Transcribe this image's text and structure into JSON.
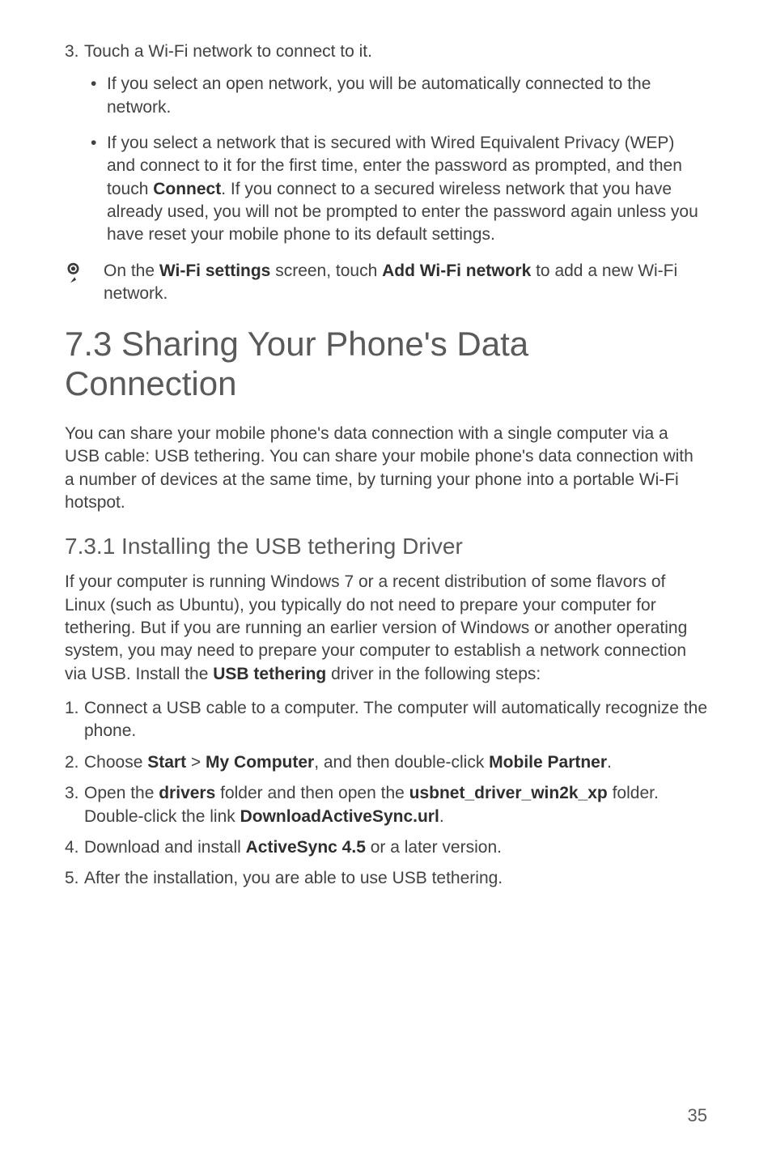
{
  "top_list": {
    "num": "3.",
    "text": "Touch a Wi-Fi network to connect to it.",
    "bullets": [
      "If you select an open network, you will be automatically connected to the network.",
      "If you select a network that is secured with Wired Equivalent Privacy (WEP) and connect to it for the first time, enter the password as prompted, and then touch <strong>Connect</strong>. If you connect to a secured wireless network that you have already used, you will not be prompted to enter the password again unless you have reset your mobile phone to its default settings."
    ]
  },
  "note": "On the <strong>Wi-Fi settings</strong> screen, touch <strong>Add Wi-Fi network</strong> to add a new Wi-Fi network.",
  "section_heading": "7.3  Sharing Your Phone's Data Connection",
  "section_para": "You can share your mobile phone's data connection with a single computer via a USB cable: USB tethering. You can share your mobile phone's data connection with a number of devices at the same time, by turning your phone into a portable Wi-Fi hotspot.",
  "subsection_heading": "7.3.1   Installing  the  USB  tethering  Driver",
  "subsection_para": "If your computer is running Windows 7 or a recent distribution of some flavors of Linux (such as Ubuntu), you typically do not need to prepare your computer for tethering. But if you are running an earlier version of Windows or another operating system, you may need to prepare your computer to establish a network connection via USB. Install the <strong>USB tethering</strong> driver in the following steps:",
  "steps": [
    {
      "num": "1.",
      "text": "Connect a USB cable to a computer. The computer will automatically recognize the phone."
    },
    {
      "num": "2.",
      "text": "Choose <strong>Start</strong> > <strong>My Computer</strong>, and then double-click <strong>Mobile Partner</strong>."
    },
    {
      "num": "3.",
      "text": "Open the <strong>drivers</strong> folder and then open the <strong>usbnet_driver_win2k_xp</strong> folder. Double-click the link <strong>DownloadActiveSync.url</strong>."
    },
    {
      "num": "4.",
      "text": "Download and install <strong>ActiveSync 4.5</strong> or a later version."
    },
    {
      "num": "5.",
      "text": "After the installation, you are able to use USB tethering."
    }
  ],
  "page_number": "35"
}
